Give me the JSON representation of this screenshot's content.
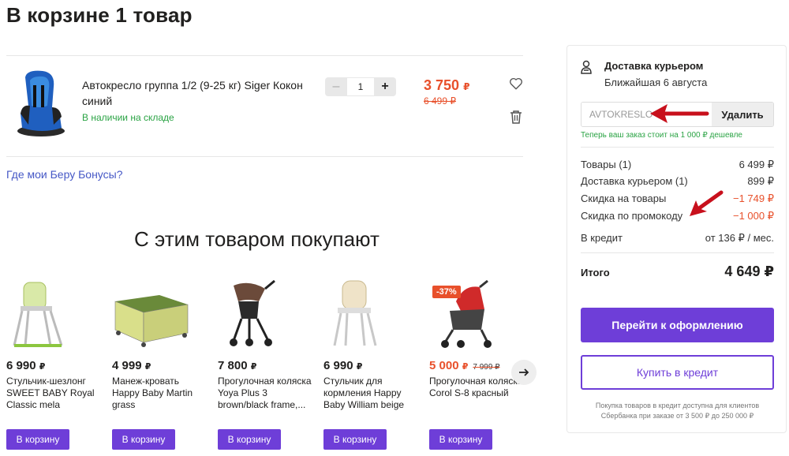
{
  "page": {
    "title": "В корзине 1 товар"
  },
  "cart_item": {
    "title": "Автокресло группа 1/2 (9-25 кг) Siger Кокон синий",
    "stock": "В наличии на складе",
    "quantity": "1",
    "qty_minus": "–",
    "qty_plus": "+",
    "price": "3 750",
    "currency": "₽",
    "old_price": "6 499 ₽"
  },
  "bonus_link": "Где мои Беру Бонусы?",
  "recommendations": {
    "title": "С этим товаром покупают",
    "products": [
      {
        "price": "6 990",
        "currency": "₽",
        "name": "Стульчик-шезлонг SWEET BABY Royal Classic mela",
        "button": "В корзину"
      },
      {
        "price": "4 999",
        "currency": "₽",
        "name": "Манеж-кровать Happy Baby Martin grass",
        "button": "В корзину"
      },
      {
        "price": "7 800",
        "currency": "₽",
        "name": "Прогулочная коляска Yoya Plus 3 brown/black frame,...",
        "button": "В корзину"
      },
      {
        "price": "6 990",
        "currency": "₽",
        "name": "Стульчик для кормления Happy Baby William beige",
        "button": "В корзину"
      },
      {
        "price": "5 000",
        "currency": "₽",
        "old_price": "7 999 ₽",
        "badge": "-37%",
        "name": "Прогулочная коляска Corol S-8 красный",
        "button": "В корзину"
      }
    ],
    "next_icon": "arrow-right-icon"
  },
  "sidebar": {
    "delivery_title": "Доставка курьером",
    "delivery_date": "Ближайшая 6 августа",
    "promo_value": "AVTOKRESLO",
    "promo_button": "Удалить",
    "promo_note": "Теперь ваш заказ стоит на 1 000 ₽ дешевле",
    "rows": [
      {
        "label": "Товары (1)",
        "value": "6 499 ₽"
      },
      {
        "label": "Доставка курьером (1)",
        "value": "899 ₽"
      },
      {
        "label": "Скидка на товары",
        "value": "−1 749 ₽"
      },
      {
        "label": "Скидка по промокоду",
        "value": "−1 000 ₽"
      },
      {
        "label": "В кредит",
        "value": "от 136 ₽ / мес."
      }
    ],
    "total_label": "Итого",
    "total_value": "4 649 ₽",
    "checkout_button": "Перейти к оформлению",
    "credit_button": "Купить в кредит",
    "credit_note": "Покупка товаров в кредит доступна для клиентов Сбербанка при заказе от 3 500 ₽ до 250 000 ₽"
  },
  "colors": {
    "accent": "#6e3ed8",
    "sale": "#e8502b",
    "stock": "#2aa344",
    "link": "#4658c6",
    "annotation_arrow": "#c8101c"
  }
}
